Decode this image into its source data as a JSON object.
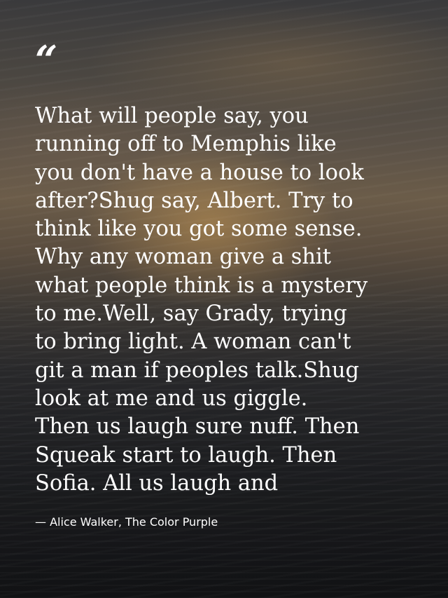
{
  "quote": {
    "mark": "“",
    "text": "What will people say, you\nrunning off to Memphis like\nyou don't have a house to look\nafter?Shug say, Albert. Try to\nthink like you got some sense.\nWhy any woman give a shit\nwhat people think is a mystery\nto me.Well, say Grady, trying\nto bring light. A woman can't\ngit a man if peoples talk.Shug\nlook at me and us giggle.\nThen us laugh sure nuff. Then\nSqueak start to laugh. Then\nSofia. All us laugh and",
    "attribution": "— Alice Walker, The Color Purple"
  },
  "colors": {
    "text": "#ffffff",
    "sky_warm": "#6b5c49",
    "sea_dark": "#17181b"
  }
}
